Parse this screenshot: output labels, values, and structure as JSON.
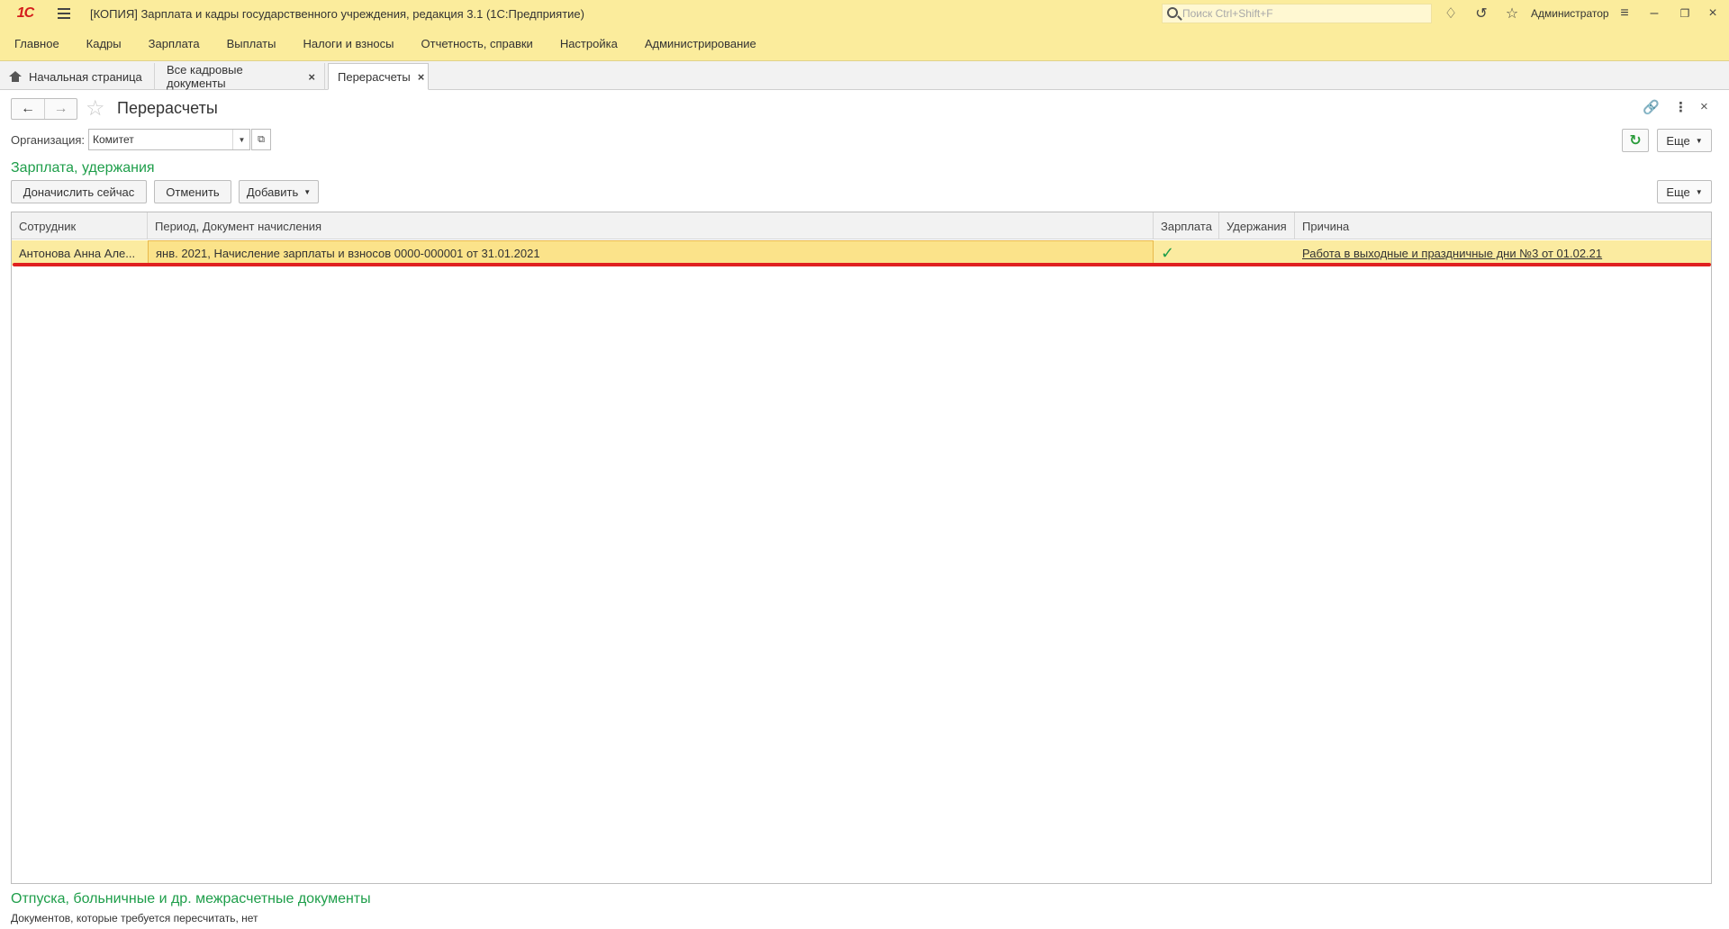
{
  "app": {
    "logo_text": "1C",
    "window_title": "[КОПИЯ] Зарплата и кадры государственного учреждения, редакция 3.1  (1С:Предприятие)",
    "search_placeholder": "Поиск Ctrl+Shift+F",
    "user": "Администратор"
  },
  "menu": [
    "Главное",
    "Кадры",
    "Зарплата",
    "Выплаты",
    "Налоги и взносы",
    "Отчетность, справки",
    "Настройка",
    "Администрирование"
  ],
  "tabs": [
    {
      "label": "Начальная страница"
    },
    {
      "label": "Все кадровые документы",
      "close": "×"
    },
    {
      "label": "Перерасчеты",
      "close": "×"
    }
  ],
  "page": {
    "title": "Перерасчеты",
    "org_label": "Организация:",
    "org_value": "Комитет",
    "more_label": "Еще"
  },
  "section1": {
    "title": "Зарплата, удержания",
    "buttons": {
      "accrue_now": "Доначислить сейчас",
      "cancel": "Отменить",
      "add": "Добавить",
      "more": "Еще"
    },
    "columns": [
      "Сотрудник",
      "Период, Документ начисления",
      "Зарплата",
      "Удержания",
      "Причина"
    ],
    "rows": [
      {
        "employee": "Антонова Анна Але...",
        "period_doc": "янв. 2021, Начисление зарплаты и взносов 0000-000001 от 31.01.2021",
        "salary_mark": "✓",
        "deductions": "",
        "reason": "Работа в выходные и праздничные дни №3 от 01.02.21"
      }
    ]
  },
  "section2": {
    "title": "Отпуска, больничные и др. межрасчетные документы",
    "text": "Документов, которые требуется пересчитать, нет"
  },
  "colors": {
    "header_bg": "#fbec9c",
    "section_green": "#1e9e4a",
    "row_highlight": "#fbeba0",
    "annotation_red": "#e02020"
  }
}
